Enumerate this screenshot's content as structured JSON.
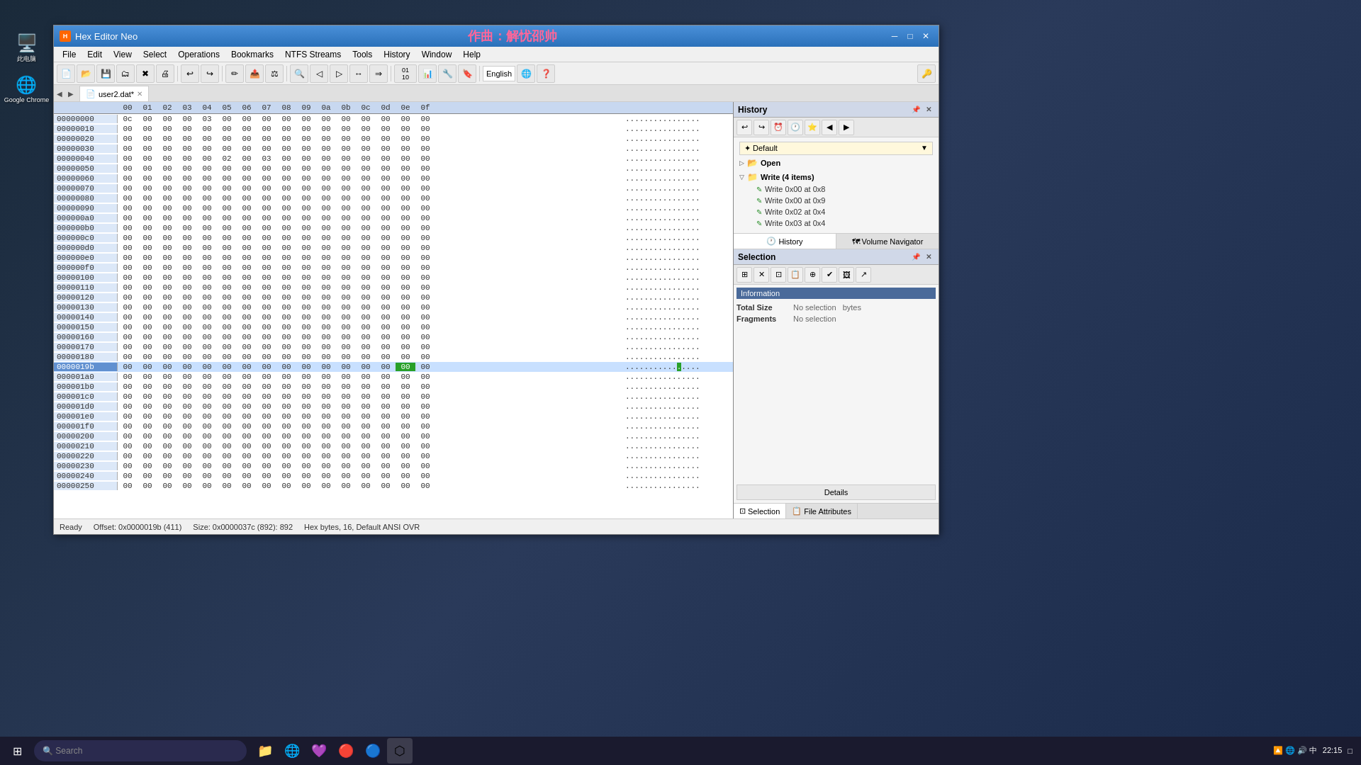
{
  "window": {
    "title": "Hex Editor Neo",
    "watermark": "作曲：解忧邵帅",
    "tab_filename": "user2.dat*"
  },
  "menu": {
    "items": [
      "File",
      "Edit",
      "View",
      "Select",
      "Operations",
      "Bookmarks",
      "NTFS Streams",
      "Tools",
      "History",
      "Window",
      "Help"
    ]
  },
  "toolbar": {
    "language": "English"
  },
  "hex_data": {
    "column_headers": [
      "00",
      "01",
      "02",
      "03",
      "04",
      "05",
      "06",
      "07",
      "08",
      "09",
      "0a",
      "0b",
      "0c",
      "0d",
      "0e",
      "0f"
    ],
    "highlighted_addr": "0000019b",
    "cursor_offset": "0x0000019b",
    "rows": [
      {
        "addr": "00000000",
        "bytes": [
          "0c",
          "00",
          "00",
          "00",
          "03",
          "00",
          "00",
          "00",
          "00",
          "00",
          "00",
          "00",
          "00",
          "00",
          "00",
          "00"
        ],
        "ascii": "................"
      },
      {
        "addr": "00000010",
        "bytes": [
          "00",
          "00",
          "00",
          "00",
          "00",
          "00",
          "00",
          "00",
          "00",
          "00",
          "00",
          "00",
          "00",
          "00",
          "00",
          "00"
        ],
        "ascii": "................"
      },
      {
        "addr": "00000020",
        "bytes": [
          "00",
          "00",
          "00",
          "00",
          "00",
          "00",
          "00",
          "00",
          "00",
          "00",
          "00",
          "00",
          "00",
          "00",
          "00",
          "00"
        ],
        "ascii": "................"
      },
      {
        "addr": "00000030",
        "bytes": [
          "00",
          "00",
          "00",
          "00",
          "00",
          "00",
          "00",
          "00",
          "00",
          "00",
          "00",
          "00",
          "00",
          "00",
          "00",
          "00"
        ],
        "ascii": "................"
      },
      {
        "addr": "00000040",
        "bytes": [
          "00",
          "00",
          "00",
          "00",
          "00",
          "02",
          "00",
          "03",
          "00",
          "00",
          "00",
          "00",
          "00",
          "00",
          "00",
          "00"
        ],
        "ascii": "................"
      },
      {
        "addr": "00000050",
        "bytes": [
          "00",
          "00",
          "00",
          "00",
          "00",
          "00",
          "00",
          "00",
          "00",
          "00",
          "00",
          "00",
          "00",
          "00",
          "00",
          "00"
        ],
        "ascii": "................"
      },
      {
        "addr": "00000060",
        "bytes": [
          "00",
          "00",
          "00",
          "00",
          "00",
          "00",
          "00",
          "00",
          "00",
          "00",
          "00",
          "00",
          "00",
          "00",
          "00",
          "00"
        ],
        "ascii": "................"
      },
      {
        "addr": "00000070",
        "bytes": [
          "00",
          "00",
          "00",
          "00",
          "00",
          "00",
          "00",
          "00",
          "00",
          "00",
          "00",
          "00",
          "00",
          "00",
          "00",
          "00"
        ],
        "ascii": "................"
      },
      {
        "addr": "00000080",
        "bytes": [
          "00",
          "00",
          "00",
          "00",
          "00",
          "00",
          "00",
          "00",
          "00",
          "00",
          "00",
          "00",
          "00",
          "00",
          "00",
          "00"
        ],
        "ascii": "................"
      },
      {
        "addr": "00000090",
        "bytes": [
          "00",
          "00",
          "00",
          "00",
          "00",
          "00",
          "00",
          "00",
          "00",
          "00",
          "00",
          "00",
          "00",
          "00",
          "00",
          "00"
        ],
        "ascii": "................"
      },
      {
        "addr": "000000a0",
        "bytes": [
          "00",
          "00",
          "00",
          "00",
          "00",
          "00",
          "00",
          "00",
          "00",
          "00",
          "00",
          "00",
          "00",
          "00",
          "00",
          "00"
        ],
        "ascii": "................"
      },
      {
        "addr": "000000b0",
        "bytes": [
          "00",
          "00",
          "00",
          "00",
          "00",
          "00",
          "00",
          "00",
          "00",
          "00",
          "00",
          "00",
          "00",
          "00",
          "00",
          "00"
        ],
        "ascii": "................"
      },
      {
        "addr": "000000c0",
        "bytes": [
          "00",
          "00",
          "00",
          "00",
          "00",
          "00",
          "00",
          "00",
          "00",
          "00",
          "00",
          "00",
          "00",
          "00",
          "00",
          "00"
        ],
        "ascii": "................"
      },
      {
        "addr": "000000d0",
        "bytes": [
          "00",
          "00",
          "00",
          "00",
          "00",
          "00",
          "00",
          "00",
          "00",
          "00",
          "00",
          "00",
          "00",
          "00",
          "00",
          "00"
        ],
        "ascii": "................"
      },
      {
        "addr": "000000e0",
        "bytes": [
          "00",
          "00",
          "00",
          "00",
          "00",
          "00",
          "00",
          "00",
          "00",
          "00",
          "00",
          "00",
          "00",
          "00",
          "00",
          "00"
        ],
        "ascii": "................"
      },
      {
        "addr": "000000f0",
        "bytes": [
          "00",
          "00",
          "00",
          "00",
          "00",
          "00",
          "00",
          "00",
          "00",
          "00",
          "00",
          "00",
          "00",
          "00",
          "00",
          "00"
        ],
        "ascii": "................"
      },
      {
        "addr": "00000100",
        "bytes": [
          "00",
          "00",
          "00",
          "00",
          "00",
          "00",
          "00",
          "00",
          "00",
          "00",
          "00",
          "00",
          "00",
          "00",
          "00",
          "00"
        ],
        "ascii": "................"
      },
      {
        "addr": "00000110",
        "bytes": [
          "00",
          "00",
          "00",
          "00",
          "00",
          "00",
          "00",
          "00",
          "00",
          "00",
          "00",
          "00",
          "00",
          "00",
          "00",
          "00"
        ],
        "ascii": "................"
      },
      {
        "addr": "00000120",
        "bytes": [
          "00",
          "00",
          "00",
          "00",
          "00",
          "00",
          "00",
          "00",
          "00",
          "00",
          "00",
          "00",
          "00",
          "00",
          "00",
          "00"
        ],
        "ascii": "................"
      },
      {
        "addr": "00000130",
        "bytes": [
          "00",
          "00",
          "00",
          "00",
          "00",
          "00",
          "00",
          "00",
          "00",
          "00",
          "00",
          "00",
          "00",
          "00",
          "00",
          "00"
        ],
        "ascii": "................"
      },
      {
        "addr": "00000140",
        "bytes": [
          "00",
          "00",
          "00",
          "00",
          "00",
          "00",
          "00",
          "00",
          "00",
          "00",
          "00",
          "00",
          "00",
          "00",
          "00",
          "00"
        ],
        "ascii": "................"
      },
      {
        "addr": "00000150",
        "bytes": [
          "00",
          "00",
          "00",
          "00",
          "00",
          "00",
          "00",
          "00",
          "00",
          "00",
          "00",
          "00",
          "00",
          "00",
          "00",
          "00"
        ],
        "ascii": "................"
      },
      {
        "addr": "00000160",
        "bytes": [
          "00",
          "00",
          "00",
          "00",
          "00",
          "00",
          "00",
          "00",
          "00",
          "00",
          "00",
          "00",
          "00",
          "00",
          "00",
          "00"
        ],
        "ascii": "................"
      },
      {
        "addr": "00000170",
        "bytes": [
          "00",
          "00",
          "00",
          "00",
          "00",
          "00",
          "00",
          "00",
          "00",
          "00",
          "00",
          "00",
          "00",
          "00",
          "00",
          "00"
        ],
        "ascii": "................"
      },
      {
        "addr": "00000180",
        "bytes": [
          "00",
          "00",
          "00",
          "00",
          "00",
          "00",
          "00",
          "00",
          "00",
          "00",
          "00",
          "00",
          "00",
          "00",
          "00",
          "00"
        ],
        "ascii": "................"
      },
      {
        "addr": "0000019b",
        "bytes": [
          "00",
          "00",
          "00",
          "00",
          "00",
          "00",
          "00",
          "00",
          "00",
          "00",
          "00",
          "00",
          "00",
          "00",
          "00",
          "00"
        ],
        "ascii": "..........█.....",
        "highlighted": true,
        "cursor_byte_index": 14
      },
      {
        "addr": "000001a0",
        "bytes": [
          "00",
          "00",
          "00",
          "00",
          "00",
          "00",
          "00",
          "00",
          "00",
          "00",
          "00",
          "00",
          "00",
          "00",
          "00",
          "00"
        ],
        "ascii": "................"
      },
      {
        "addr": "000001b0",
        "bytes": [
          "00",
          "00",
          "00",
          "00",
          "00",
          "00",
          "00",
          "00",
          "00",
          "00",
          "00",
          "00",
          "00",
          "00",
          "00",
          "00"
        ],
        "ascii": "................"
      },
      {
        "addr": "000001c0",
        "bytes": [
          "00",
          "00",
          "00",
          "00",
          "00",
          "00",
          "00",
          "00",
          "00",
          "00",
          "00",
          "00",
          "00",
          "00",
          "00",
          "00"
        ],
        "ascii": "................"
      },
      {
        "addr": "000001d0",
        "bytes": [
          "00",
          "00",
          "00",
          "00",
          "00",
          "00",
          "00",
          "00",
          "00",
          "00",
          "00",
          "00",
          "00",
          "00",
          "00",
          "00"
        ],
        "ascii": "................"
      },
      {
        "addr": "000001e0",
        "bytes": [
          "00",
          "00",
          "00",
          "00",
          "00",
          "00",
          "00",
          "00",
          "00",
          "00",
          "00",
          "00",
          "00",
          "00",
          "00",
          "00"
        ],
        "ascii": "................"
      },
      {
        "addr": "000001f0",
        "bytes": [
          "00",
          "00",
          "00",
          "00",
          "00",
          "00",
          "00",
          "00",
          "00",
          "00",
          "00",
          "00",
          "00",
          "00",
          "00",
          "00"
        ],
        "ascii": "................"
      },
      {
        "addr": "00000200",
        "bytes": [
          "00",
          "00",
          "00",
          "00",
          "00",
          "00",
          "00",
          "00",
          "00",
          "00",
          "00",
          "00",
          "00",
          "00",
          "00",
          "00"
        ],
        "ascii": "................"
      },
      {
        "addr": "00000210",
        "bytes": [
          "00",
          "00",
          "00",
          "00",
          "00",
          "00",
          "00",
          "00",
          "00",
          "00",
          "00",
          "00",
          "00",
          "00",
          "00",
          "00"
        ],
        "ascii": "................"
      },
      {
        "addr": "00000220",
        "bytes": [
          "00",
          "00",
          "00",
          "00",
          "00",
          "00",
          "00",
          "00",
          "00",
          "00",
          "00",
          "00",
          "00",
          "00",
          "00",
          "00"
        ],
        "ascii": "................"
      },
      {
        "addr": "00000230",
        "bytes": [
          "00",
          "00",
          "00",
          "00",
          "00",
          "00",
          "00",
          "00",
          "00",
          "00",
          "00",
          "00",
          "00",
          "00",
          "00",
          "00"
        ],
        "ascii": "................"
      },
      {
        "addr": "00000240",
        "bytes": [
          "00",
          "00",
          "00",
          "00",
          "00",
          "00",
          "00",
          "00",
          "00",
          "00",
          "00",
          "00",
          "00",
          "00",
          "00",
          "00"
        ],
        "ascii": "................"
      },
      {
        "addr": "00000250",
        "bytes": [
          "00",
          "00",
          "00",
          "00",
          "00",
          "00",
          "00",
          "00",
          "00",
          "00",
          "00",
          "00",
          "00",
          "00",
          "00",
          "00"
        ],
        "ascii": "................"
      }
    ]
  },
  "history_panel": {
    "title": "History",
    "default_label": "Default",
    "open_label": "Open",
    "write_group_label": "Write (4 items)",
    "write_items": [
      "Write 0x00 at 0x8",
      "Write 0x00 at 0x9",
      "Write 0x02 at 0x4",
      "Write 0x03 at 0x4"
    ],
    "tabs": [
      "History",
      "Volume Navigator"
    ]
  },
  "selection_panel": {
    "title": "Selection",
    "info_header": "Information",
    "total_size_label": "Total Size",
    "total_size_value": "No selection",
    "total_size_unit": "bytes",
    "fragments_label": "Fragments",
    "fragments_value": "No selection",
    "details_btn": "Details"
  },
  "bottom_tabs": [
    "Selection",
    "File Attributes"
  ],
  "status_bar": {
    "ready": "Ready",
    "offset": "Offset: 0x0000019b (411)",
    "size": "Size: 0x0000037c (892): 892",
    "info": "Hex bytes, 16, Default ANSI OVR"
  },
  "sidebar_items": [
    {
      "label": "此电脑",
      "icon": "🖥️"
    },
    {
      "label": "Google Chrome",
      "icon": "🌐"
    }
  ],
  "taskbar": {
    "time": "22:15",
    "apps": [
      "⊞",
      "🔍",
      "📁",
      "🌐",
      "💜",
      "🔴",
      "🔵",
      "⚙️"
    ]
  }
}
